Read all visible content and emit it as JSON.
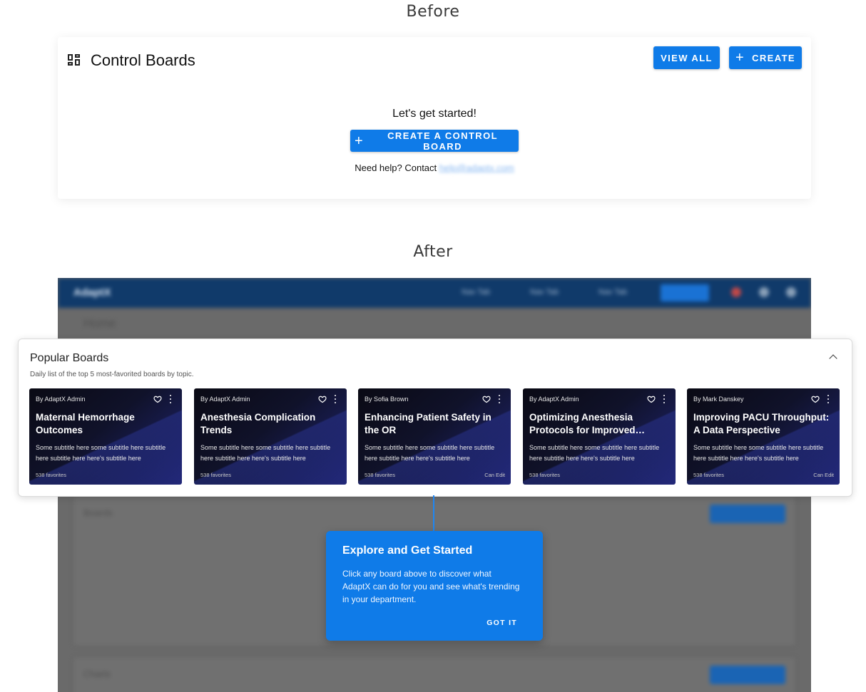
{
  "before": {
    "heading": "Before",
    "title": "Control Boards",
    "view_all_label": "VIEW ALL",
    "create_label": "CREATE",
    "started_text": "Let's get started!",
    "create_board_label": "CREATE A CONTROL BOARD",
    "help_text": "Need help? Contact",
    "help_email": "help@adaptx.com"
  },
  "after": {
    "heading": "After",
    "app": {
      "logo": "AdaptX",
      "tabs": [
        "Nav Tab",
        "Nav Tab",
        "Nav Tab"
      ],
      "create_label": "CREATE",
      "home_label": "Home",
      "boards_label": "Boards",
      "create_board_label": "CREATE BOARD",
      "charts_label": "Charts",
      "create_chart_label": "CREATE CHART"
    },
    "popular": {
      "title": "Popular Boards",
      "subtitle": "Daily list of the top 5 most-favorited boards by topic.",
      "cards": [
        {
          "author": "By AdaptX Admin",
          "title": "Maternal Hemorrhage Outcomes",
          "subtitle": "Some subtitle here some subtitle here subtitle here subtitle here here's subtitle here",
          "favorites": "538 favorites",
          "edit": ""
        },
        {
          "author": "By AdaptX Admin",
          "title": "Anesthesia Complication Trends",
          "subtitle": "Some subtitle here some subtitle here subtitle here subtitle here here's subtitle here",
          "favorites": "538 favorites",
          "edit": ""
        },
        {
          "author": "By Sofia Brown",
          "title": "Enhancing Patient Safety in the OR",
          "subtitle": "Some subtitle here some subtitle here subtitle here subtitle here here's subtitle here",
          "favorites": "538 favorites",
          "edit": "Can Edit"
        },
        {
          "author": "By AdaptX Admin",
          "title": "Optimizing Anesthesia Protocols for Improved Outcomes",
          "subtitle": "Some subtitle here some subtitle here subtitle here subtitle here here's subtitle here",
          "favorites": "538 favorites",
          "edit": ""
        },
        {
          "author": "By Mark Danskey",
          "title": "Improving PACU Throughput: A Data Perspective",
          "subtitle": "Some subtitle here some subtitle here subtitle here subtitle here here's subtitle here",
          "favorites": "538 favorites",
          "edit": "Can Edit"
        }
      ]
    },
    "tooltip": {
      "title": "Explore and Get Started",
      "body": "Click any board above to discover what AdaptX can do for you and see what's trending in your department.",
      "button_label": "GOT IT"
    }
  },
  "colors": {
    "primary": "#0f7be8",
    "nav": "#103a6a",
    "overlay": "#6a6a6a"
  }
}
